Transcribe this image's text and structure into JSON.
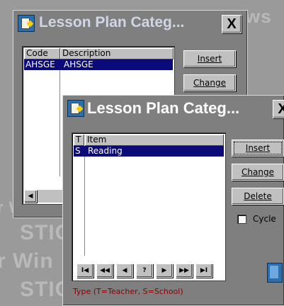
{
  "background": {
    "texts": [
      "STIC",
      "r Win",
      "STIC",
      "r Win",
      "STIC"
    ]
  },
  "back_window": {
    "title": "Lesson Plan Categ...",
    "close_label": "X",
    "columns": [
      "Code",
      "Description"
    ],
    "rows": [
      {
        "code": "AHSGE",
        "description": "AHSGE"
      }
    ],
    "insert_label": "Insert",
    "change_label": "Change"
  },
  "front_window": {
    "title": "Lesson Plan Categ...",
    "close_label": "X",
    "columns": [
      "T",
      "Item"
    ],
    "rows": [
      {
        "type": "S",
        "item": "Reading"
      }
    ],
    "buttons": {
      "insert": "Insert",
      "change": "Change",
      "delete": "Delete"
    },
    "cycle_label": "Cycle",
    "cycle_checked": false,
    "nav": [
      "I◀",
      "◀◀",
      "◀",
      "?",
      "▶",
      "▶▶",
      "▶I"
    ],
    "legend": "Type (T=Teacher, S=School)"
  },
  "colors": {
    "selection": "#0a0a78",
    "legend_text": "#8b0000"
  }
}
